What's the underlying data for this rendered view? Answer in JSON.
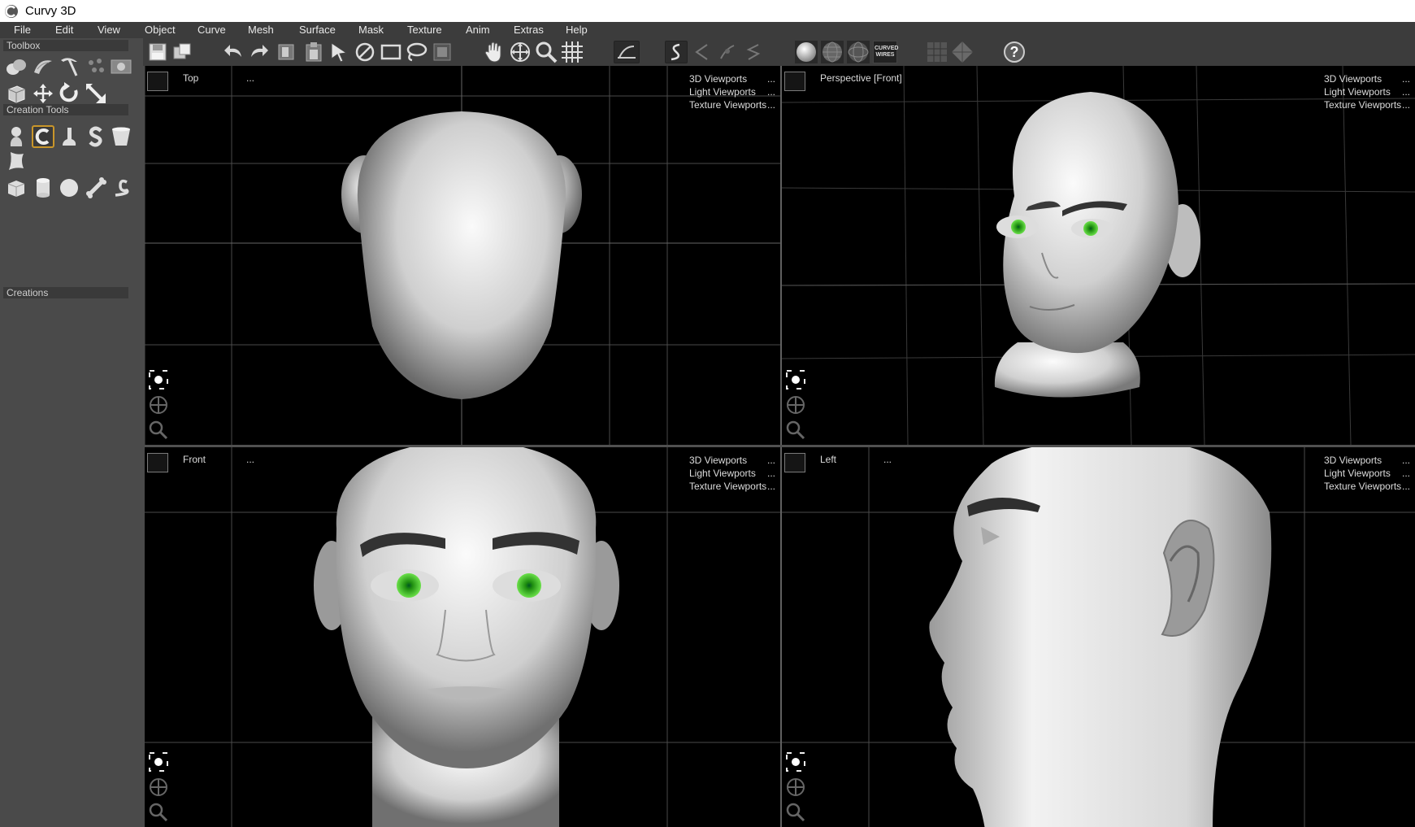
{
  "window": {
    "title": "Curvy 3D"
  },
  "menu": [
    "File",
    "Edit",
    "View",
    "Object",
    "Curve",
    "Mesh",
    "Surface",
    "Mask",
    "Texture",
    "Anim",
    "Extras",
    "Help"
  ],
  "toolbar": {
    "icons": [
      "save-icon",
      "save-as-icon",
      "undo-icon",
      "redo-icon",
      "copy-icon",
      "paste-icon",
      "select-arrow-icon",
      "no-select-icon",
      "rectangle-select-icon",
      "lasso-icon",
      "mask-icon",
      "pan-hand-icon",
      "move-icon",
      "zoom-icon",
      "grid-icon",
      "measure-icon",
      "curve-icon",
      "curve-disabled-icon",
      "curve-node-icon",
      "curve-edit-icon",
      "smooth-shading-icon",
      "wire-shading-icon",
      "wire-shading-alt-icon",
      "curved-wires-icon",
      "flat-grid-icon",
      "diamond-grid-icon",
      "help-icon"
    ],
    "curved_wires_label": "CURVED WIRES"
  },
  "left_panel": {
    "toolbox_header": "Toolbox",
    "creation_tools_header": "Creation Tools",
    "creations_header": "Creations"
  },
  "viewports": [
    {
      "name": "Top",
      "dots": "...",
      "menu": [
        "3D Viewports",
        "Light Viewports",
        "Texture Viewports"
      ]
    },
    {
      "name": "Perspective [Front]",
      "dots": "",
      "menu": [
        "3D Viewports",
        "Light Viewports",
        "Texture Viewports"
      ]
    },
    {
      "name": "Front",
      "dots": "...",
      "menu": [
        "3D Viewports",
        "Light Viewports",
        "Texture Viewports"
      ]
    },
    {
      "name": "Left",
      "dots": "...",
      "menu": [
        "3D Viewports",
        "Light Viewports",
        "Texture Viewports"
      ]
    }
  ],
  "menu_ellipsis": "...",
  "colors": {
    "viewport_bg": "#000000",
    "grid": "#4a4a4a",
    "eye": "#2fbf1e",
    "accent_active": "#c9962a",
    "skin_light": "#f2f2f2",
    "skin_dark": "#8a8a8a"
  }
}
